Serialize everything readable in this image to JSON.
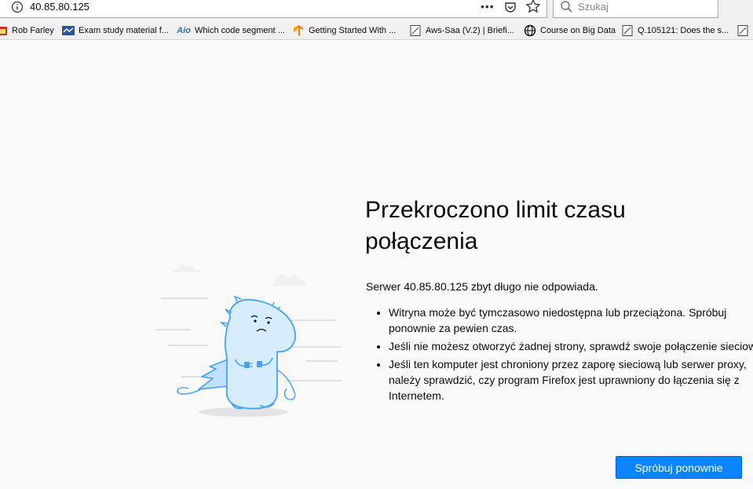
{
  "browser": {
    "url": "40.85.80.125",
    "search_placeholder": "Szukaj",
    "page_actions": "•••"
  },
  "bookmarks": [
    {
      "label": "Rob Farley",
      "icon": "red-folder-icon"
    },
    {
      "label": "Exam study material f...",
      "icon": "blue-site-icon"
    },
    {
      "label": "Which code segment ...",
      "icon": "aio-icon"
    },
    {
      "label": "Getting Started With ...",
      "icon": "tensorflow-icon"
    },
    {
      "label": "Aws-Saa (V.2) | Briefi...",
      "icon": "page-icon"
    },
    {
      "label": "Course on Big Data",
      "icon": "globe-icon"
    },
    {
      "label": "Q.105121: Does the s...",
      "icon": "page-icon"
    }
  ],
  "bookmark_aio_text": "Aio",
  "error": {
    "title_line1": "Przekroczono limit czasu",
    "title_line2": "połączenia",
    "description": "Serwer 40.85.80.125 zbyt długo nie odpowiada.",
    "tips": [
      "Witryna może być tymczasowo niedostępna lub przeciążona. Spróbuj ponownie za pewien czas.",
      "Jeśli nie możesz otworzyć żadnej strony, sprawdź swoje połączenie sieciowe.",
      "Jeśli ten komputer jest chroniony przez zaporę sieciową lub serwer proxy, należy sprawdzić, czy program Firefox jest uprawniony do łączenia się z Internetem."
    ],
    "retry_label": "Spróbuj ponownie"
  },
  "colors": {
    "accent": "#0a84ff",
    "illustration": "#45a1ff",
    "background": "#f9f9fa"
  }
}
